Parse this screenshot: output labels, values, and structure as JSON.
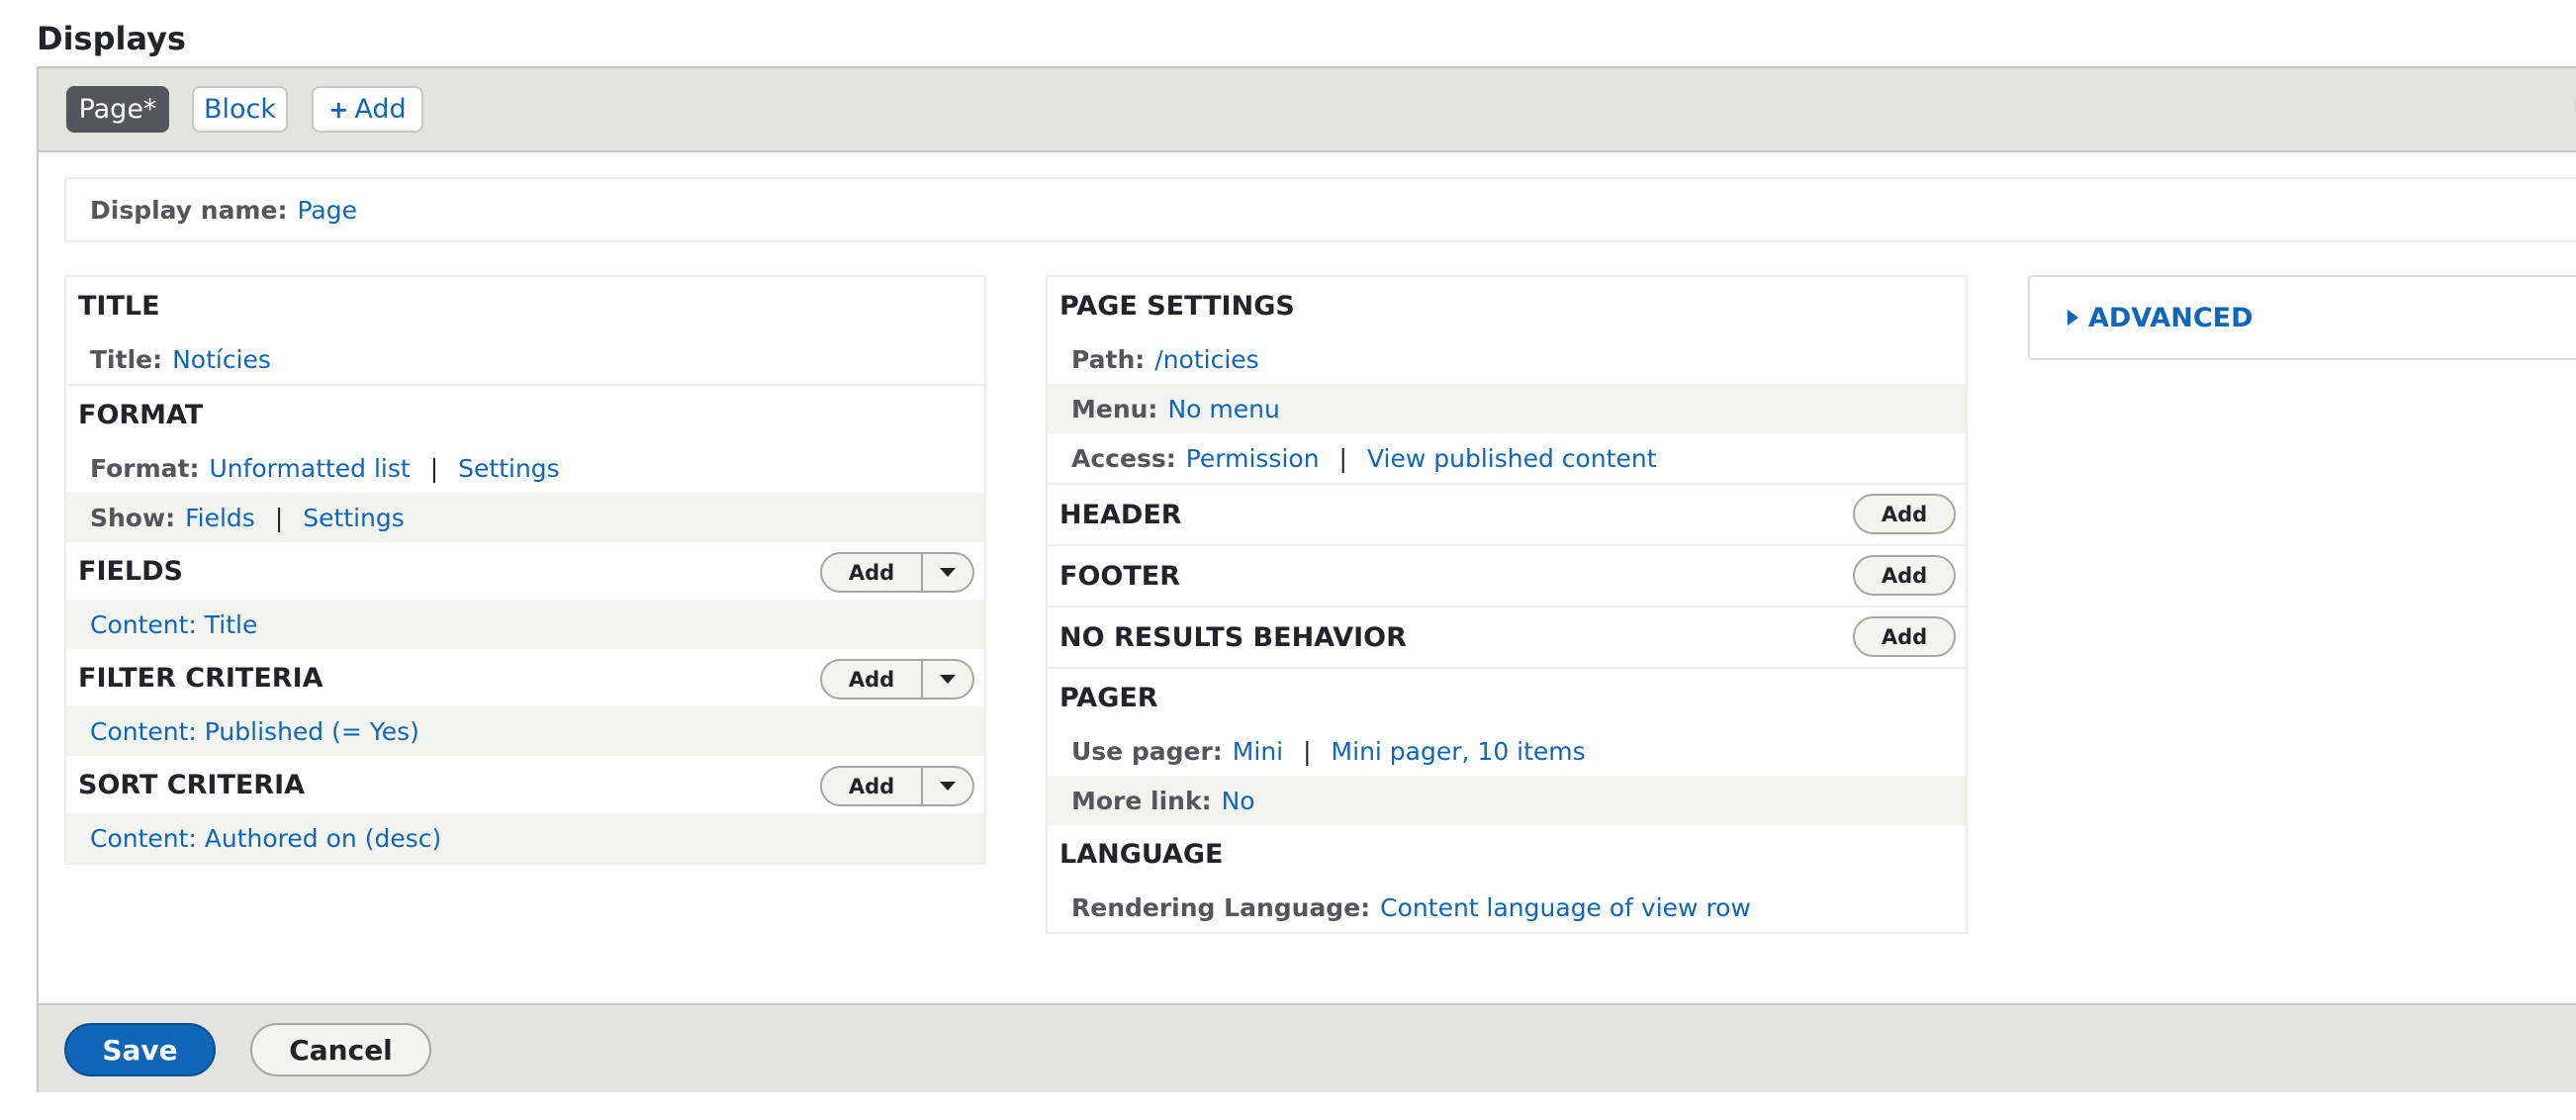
{
  "heading": "Displays",
  "tabs": {
    "active": "Page*",
    "block": "Block",
    "add": "Add",
    "add_icon": "+"
  },
  "display_name": {
    "label": "Display name:",
    "value": "Page"
  },
  "left": {
    "title": {
      "heading": "TITLE",
      "label": "Title:",
      "value": "Notícies"
    },
    "format": {
      "heading": "FORMAT",
      "format_label": "Format:",
      "format_value": "Unformatted list",
      "format_settings": "Settings",
      "show_label": "Show:",
      "show_value": "Fields",
      "show_settings": "Settings",
      "sep": "|"
    },
    "fields": {
      "heading": "FIELDS",
      "add": "Add",
      "item": "Content: Title"
    },
    "filter": {
      "heading": "FILTER CRITERIA",
      "add": "Add",
      "item": "Content: Published (= Yes)"
    },
    "sort": {
      "heading": "SORT CRITERIA",
      "add": "Add",
      "item": "Content: Authored on (desc)"
    }
  },
  "middle": {
    "page_settings": {
      "heading": "PAGE SETTINGS",
      "path_label": "Path:",
      "path_value": "/noticies",
      "menu_label": "Menu:",
      "menu_value": "No menu",
      "access_label": "Access:",
      "access_value": "Permission",
      "access_detail": "View published content",
      "sep": "|"
    },
    "header": {
      "heading": "HEADER",
      "add": "Add"
    },
    "footer": {
      "heading": "FOOTER",
      "add": "Add"
    },
    "no_results": {
      "heading": "NO RESULTS BEHAVIOR",
      "add": "Add"
    },
    "pager": {
      "heading": "PAGER",
      "use_label": "Use pager:",
      "use_value": "Mini",
      "use_detail": "Mini pager, 10 items",
      "more_label": "More link:",
      "more_value": "No",
      "sep": "|"
    },
    "language": {
      "heading": "LANGUAGE",
      "label": "Rendering Language:",
      "value": "Content language of view row"
    }
  },
  "advanced": {
    "label": "ADVANCED"
  },
  "actions": {
    "save": "Save",
    "cancel": "Cancel"
  },
  "colors": {
    "link": "#0f65b8",
    "primary": "#0f65b8",
    "tab_active": "#55565b",
    "bar": "#e3e4df"
  }
}
